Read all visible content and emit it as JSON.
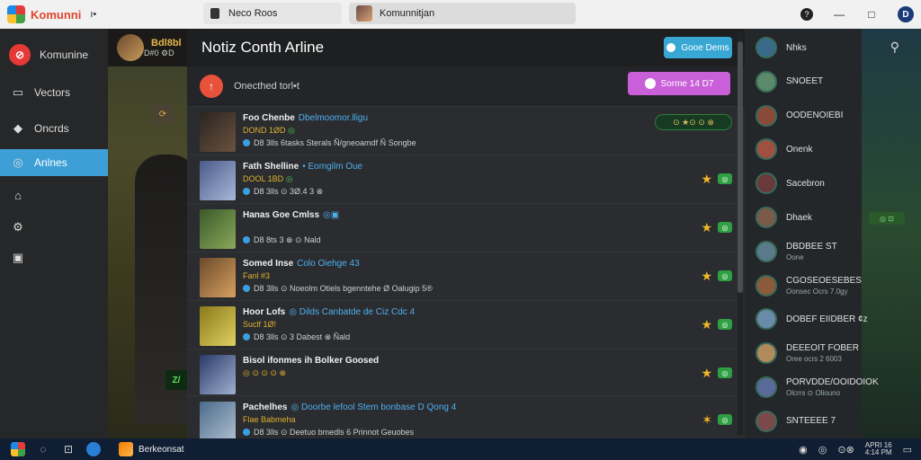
{
  "titlebar": {
    "app_name": "Komunni",
    "app_sub": "ı•",
    "tab1_label": "Neco Roos",
    "tab2_label": "Komunnitjan",
    "help_icon": "help-icon",
    "minimize_glyph": "—",
    "maximize_glyph": "□",
    "account_letter": "D"
  },
  "sidebar": {
    "brand_label": "Komunine",
    "items": [
      {
        "label": "Vectors",
        "icon": "monitor-icon",
        "glyph": "▭"
      },
      {
        "label": "Oncrds",
        "icon": "gamepad-icon",
        "glyph": "◆"
      },
      {
        "label": "Anlnes",
        "icon": "globe-icon",
        "glyph": "◎",
        "active": true
      },
      {
        "label": "",
        "icon": "home-icon",
        "glyph": "⌂"
      },
      {
        "label": "",
        "icon": "settings-icon",
        "glyph": "⚙"
      },
      {
        "label": "",
        "icon": "bag-icon",
        "glyph": "▣"
      }
    ]
  },
  "game": {
    "title": "Bdl8bl",
    "sub": "D#0 ⚙D",
    "badge": "⟳",
    "foot": "Z/"
  },
  "panel": {
    "title": "Notiz Conth Arline",
    "cyan_button": "Gooe Dems",
    "status_text": "Onecthed torl•t",
    "pink_button": "Sorme 14 D7"
  },
  "rows": [
    {
      "title": "Foo Chenbe",
      "highlight": "Dbelmoomor.lligu",
      "sub": "DOND 1ØD",
      "sub_green": "◎",
      "meta": "D8 3lls 6tasks Sterals Ñ/gneoamdf Ñ Songbe",
      "star": "",
      "badge": "⊙ ★⊙ ⊙ ⊗",
      "thumb_colors": [
        "#2a2420",
        "#6b5240"
      ]
    },
    {
      "title": "Fath Shelline",
      "highlight": "• Eomgilm Oue",
      "sub": "DOOL 1BD",
      "sub_green": "◎",
      "meta": "D8 3lls ⊙ 3Ø.4 3 ⊗",
      "star": "★",
      "badge": "◎",
      "thumb_colors": [
        "#4a5a8a",
        "#a8b8d8"
      ]
    },
    {
      "title": "Hanas Goe Cmlss",
      "highlight": "◎▣",
      "sub": "",
      "sub_green": "",
      "meta": "D8 8ts 3 ⊗ ⊙ Nald",
      "star": "★",
      "badge": "◎",
      "thumb_colors": [
        "#3a5a2a",
        "#8aa85a"
      ]
    },
    {
      "title": "Somed Inse",
      "highlight": "Colo Oiehge 43",
      "sub": "Fanl #3",
      "sub_green": "",
      "meta": "D8 3lls ⊙ Noeolm Otiels bgenntehe Ø Oalugip 5®",
      "star": "★",
      "badge": "◎",
      "thumb_colors": [
        "#6a4a2a",
        "#d8a060"
      ]
    },
    {
      "title": "Hoor Lofs",
      "highlight": "◎ Dilds Canbatde de Ciz Cdc 4",
      "sub": "Suclf 1Ø!",
      "sub_green": "",
      "meta": "D8 3lls ⊙ 3 Dabest ⊗ Ñald",
      "star": "★",
      "badge": "◎",
      "thumb_colors": [
        "#8a7a1a",
        "#e0d060"
      ]
    },
    {
      "title": "Bisol ifonmes ih Bolker Goosed",
      "highlight": "",
      "sub": "◎ ⊙ ⊙ ⊙ ⊗",
      "sub_green": "",
      "meta": "",
      "star": "★",
      "badge": "◎",
      "thumb_colors": [
        "#2a3a6a",
        "#a0b0d0"
      ]
    },
    {
      "title": "Pachelhes",
      "highlight": "◎ Doorbe lefool Stem bonbase D Qong 4",
      "sub": "Flae Babmeha",
      "sub_green": "",
      "meta": "D8 3lls ⊙ Deetuo bmedls 6 Prinnot Geuobes",
      "star": "✶",
      "badge": "◎",
      "thumb_colors": [
        "#4a6a8a",
        "#b0c0d0"
      ]
    }
  ],
  "friends": [
    {
      "name": "Nhks",
      "sub": "",
      "color": "#3a6a8a"
    },
    {
      "name": "SNOEET",
      "sub": "",
      "color": "#5a8a6a"
    },
    {
      "name": "OODENOIEBI",
      "sub": "",
      "color": "#8a4a3a"
    },
    {
      "name": "Onenk",
      "sub": "",
      "color": "#a05040"
    },
    {
      "name": "Sacebron",
      "sub": "",
      "color": "#6a3a3a"
    },
    {
      "name": "Dhaek",
      "sub": "",
      "color": "#7a5a4a"
    },
    {
      "name": "DBDBEE ST",
      "sub": "Oone",
      "color": "#5a7a8a"
    },
    {
      "name": "CGOSEOESEBES",
      "sub": "Oonsec Ocrs 7.0gy",
      "color": "#8a5a3a"
    },
    {
      "name": "DOBEF EIIDBER ¢z",
      "sub": "",
      "color": "#6a8aaa"
    },
    {
      "name": "DEEEOIT FOBER",
      "sub": "Oree ocrs 2 6003",
      "color": "#b08a5a"
    },
    {
      "name": "PORVDDE/OOIDOIOK",
      "sub": "Olcrrs ⊙ Oliouno",
      "color": "#5a6a9a"
    },
    {
      "name": "SNTEEEE 7",
      "sub": "",
      "color": "#7a4a4a"
    }
  ],
  "friends_tag": "◎ ⊡",
  "taskbar": {
    "app_label": "Berkeonsat",
    "tray_glyphs": [
      "◉",
      "◎",
      "⊙⊗",
      "▭"
    ],
    "clock_line1": "APRI 16",
    "clock_line2": "4:14 PM"
  }
}
